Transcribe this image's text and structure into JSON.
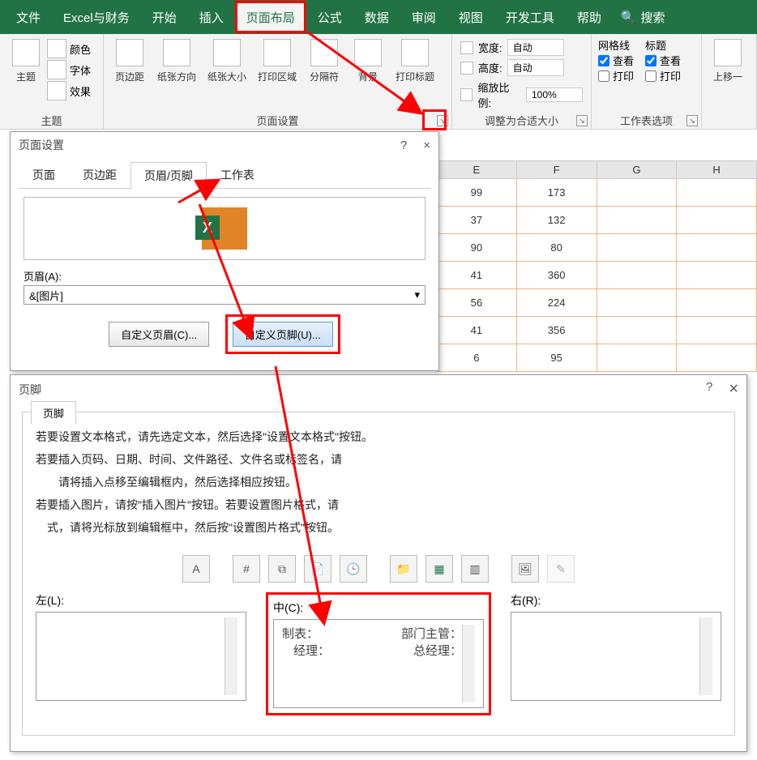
{
  "tabs": {
    "file": "文件",
    "financial": "Excel与财务",
    "home": "开始",
    "insert": "插入",
    "layout": "页面布局",
    "formula": "公式",
    "data": "数据",
    "review": "审阅",
    "view": "视图",
    "dev": "开发工具",
    "help": "帮助",
    "search": "搜索"
  },
  "groups": {
    "theme": {
      "label": "主题",
      "themes": "主题",
      "colors": "颜色",
      "fonts": "字体",
      "effects": "效果"
    },
    "pagesetup": {
      "label": "页面设置",
      "margins": "页边距",
      "orient": "纸张方向",
      "size": "纸张大小",
      "area": "打印区域",
      "breaks": "分隔符",
      "bg": "背景",
      "titles": "打印标题"
    },
    "scale": {
      "label": "调整为合适大小",
      "width": "宽度:",
      "height": "高度:",
      "zoom": "缩放比例:",
      "auto": "自动",
      "pct": "100%"
    },
    "sheetopts": {
      "label": "工作表选项",
      "grid": "网格线",
      "head": "标题",
      "view": "查看",
      "print": "打印"
    },
    "arrange": {
      "up": "上移一"
    }
  },
  "sheet": {
    "cols": [
      "E",
      "F",
      "G",
      "H"
    ],
    "rows": [
      [
        "99",
        "173"
      ],
      [
        "37",
        "132"
      ],
      [
        "90",
        "80"
      ],
      [
        "41",
        "360"
      ],
      [
        "56",
        "224"
      ],
      [
        "41",
        "356"
      ],
      [
        "6",
        "95"
      ]
    ]
  },
  "dlg1": {
    "title": "页面设置",
    "help": "?",
    "close": "×",
    "tabs": {
      "page": "页面",
      "margins": "页边距",
      "hf": "页眉/页脚",
      "sheet": "工作表"
    },
    "headerLabel": "页眉(A):",
    "headerValue": "&[图片]",
    "customHeader": "自定义页眉(C)...",
    "customFooter": "自定义页脚(U)..."
  },
  "dlg2": {
    "title": "页脚",
    "help": "?",
    "close": "×",
    "tab": "页脚",
    "instr": [
      "若要设置文本格式，请先选定文本，然后选择\"设置文本格式\"按钮。",
      "若要插入页码、日期、时间、文件路径、文件名或标签名，请",
      "　　请将插入点移至编辑框内，然后选择相应按钮。",
      "若要插入图片，请按\"插入图片\"按钮。若要设置图片格式，请",
      "　式，请将光标放到编辑框中，然后按\"设置图片格式\"按钮。"
    ],
    "toolbar": [
      "A",
      "#",
      "pg",
      "dt",
      "tm",
      "",
      "fp",
      "fn",
      "",
      "im",
      "fm"
    ],
    "left": "左(L):",
    "center": "中(C):",
    "right": "右(R):",
    "c1": "制表：",
    "c2": "部门主管：",
    "c3": "经理：",
    "c4": "总经理："
  }
}
